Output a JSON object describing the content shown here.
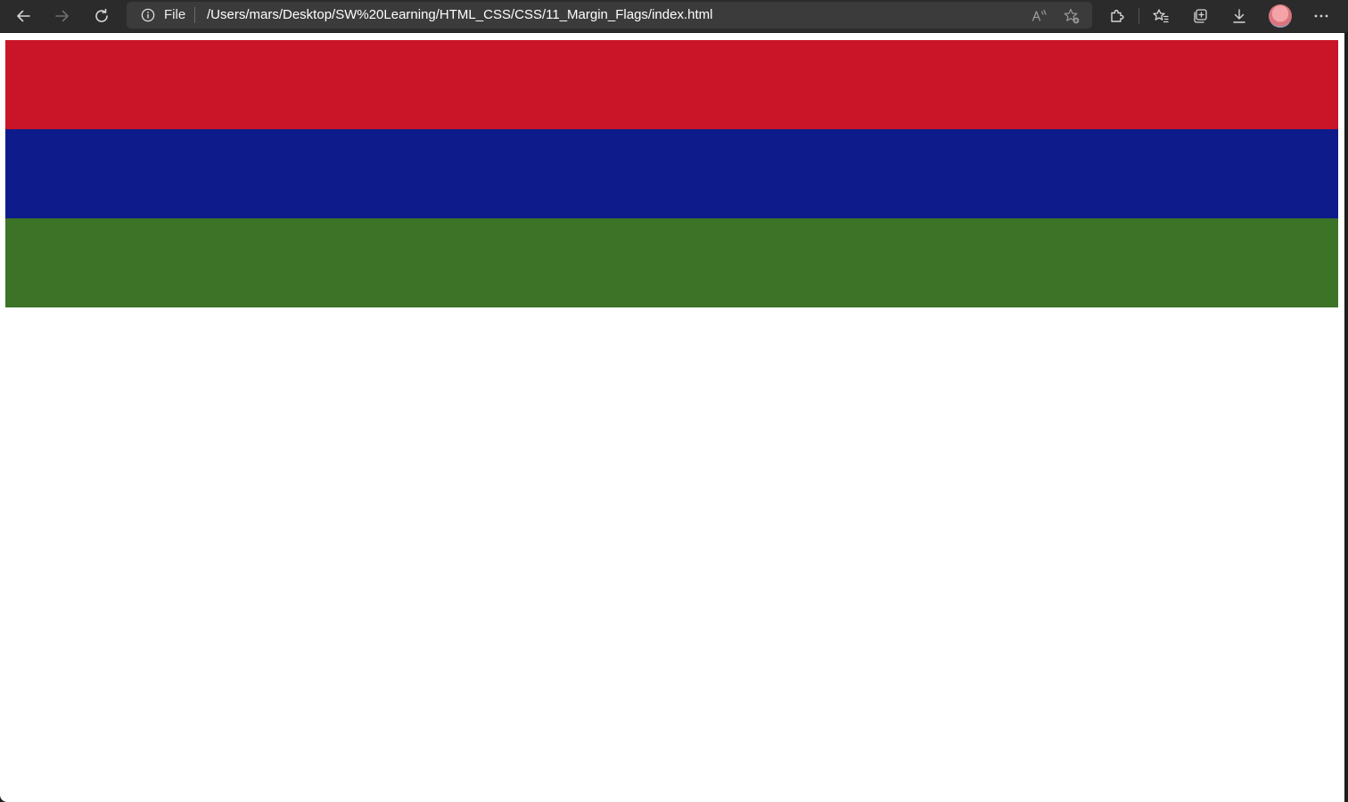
{
  "browser": {
    "address_bar": {
      "scheme_label": "File",
      "url": "/Users/mars/Desktop/SW%20Learning/HTML_CSS/CSS/11_Margin_Flags/index.html"
    },
    "icons": [
      "back-arrow-icon",
      "forward-arrow-icon",
      "reload-icon",
      "info-icon",
      "read-aloud-icon",
      "add-favorite-icon",
      "extensions-icon",
      "favorites-icon",
      "collections-icon",
      "download-icon",
      "profile-avatar",
      "more-menu-icon"
    ]
  },
  "page": {
    "flag_stripes": [
      {
        "name": "red",
        "color": "#c91527"
      },
      {
        "name": "blue",
        "color": "#0d1c8a"
      },
      {
        "name": "green",
        "color": "#3c7327"
      }
    ]
  }
}
